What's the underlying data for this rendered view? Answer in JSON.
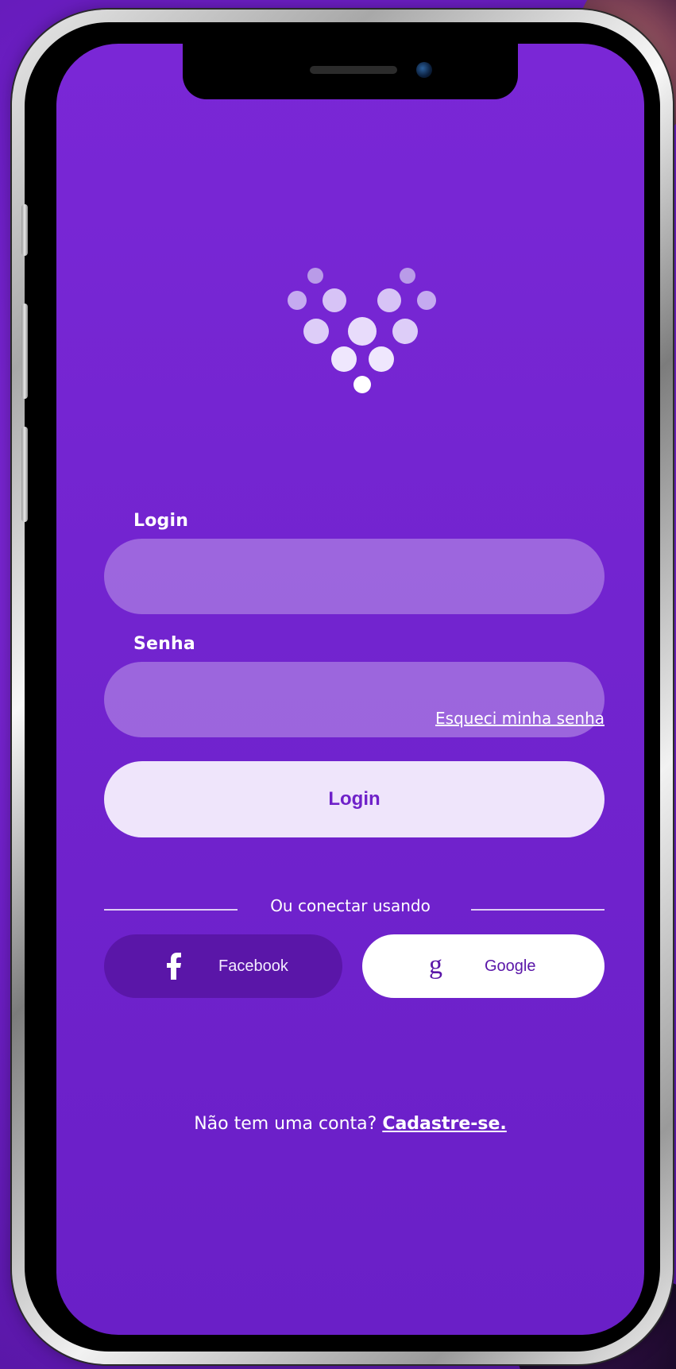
{
  "app": {
    "screen": "login",
    "brand_colors": {
      "background": "#7a27d6",
      "input_fill": "#9b6be4",
      "primary_button": "#efe5fb",
      "primary_text": "#6f21c9",
      "facebook_button": "#5a16a8",
      "google_button": "#ffffff"
    }
  },
  "form": {
    "login_label": "Login",
    "login_value": "",
    "login_placeholder": "",
    "password_label": "Senha",
    "password_value": "",
    "password_placeholder": "",
    "forgot_password": "Esqueci minha senha",
    "submit_label": "Login"
  },
  "social": {
    "divider_text": "Ou conectar usando",
    "facebook": {
      "label": "Facebook",
      "icon": "facebook-icon"
    },
    "google": {
      "label": "Google",
      "icon": "google-icon"
    }
  },
  "signup": {
    "prompt": "Não tem uma conta?",
    "cta": "Cadastre-se."
  },
  "logo": {
    "icon": "heart-dots-logo"
  }
}
